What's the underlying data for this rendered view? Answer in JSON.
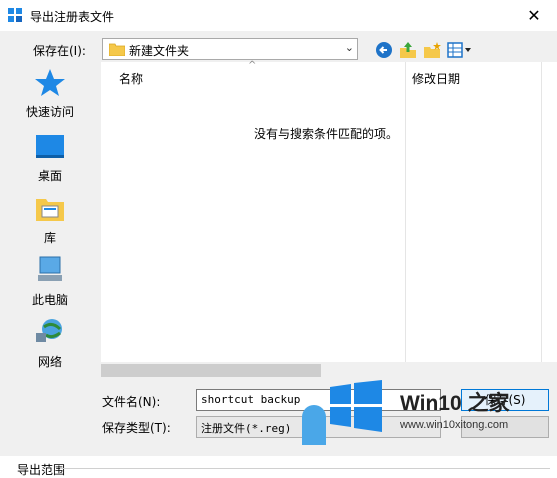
{
  "window": {
    "title": "导出注册表文件",
    "close_glyph": "✕"
  },
  "toolbar": {
    "save_in_label": "保存在(I):",
    "save_in_value": "新建文件夹",
    "icons": [
      "back-icon",
      "up-folder-icon",
      "new-folder-icon",
      "view-menu-icon"
    ]
  },
  "places": [
    {
      "label": "快速访问",
      "icon": "quick-access-star-icon"
    },
    {
      "label": "桌面",
      "icon": "desktop-icon"
    },
    {
      "label": "库",
      "icon": "library-icon"
    },
    {
      "label": "此电脑",
      "icon": "computer-icon"
    },
    {
      "label": "网络",
      "icon": "network-icon"
    }
  ],
  "filelist": {
    "columns": [
      "名称",
      "修改日期"
    ],
    "empty_message": "没有与搜索条件匹配的项。"
  },
  "form": {
    "filename_label": "文件名(N):",
    "filename_value": "shortcut backup",
    "filetype_label": "保存类型(T):",
    "filetype_value": "注册文件(*.reg)",
    "save_button": "保存(S)"
  },
  "export_range_label": "导出范围",
  "watermark": {
    "title": "Win10 之家",
    "url": "www.win10xitong.com"
  },
  "colors": {
    "accent": "#0078d7",
    "win_blue": "#1e88e5",
    "folder_yellow": "#f5c84a"
  }
}
